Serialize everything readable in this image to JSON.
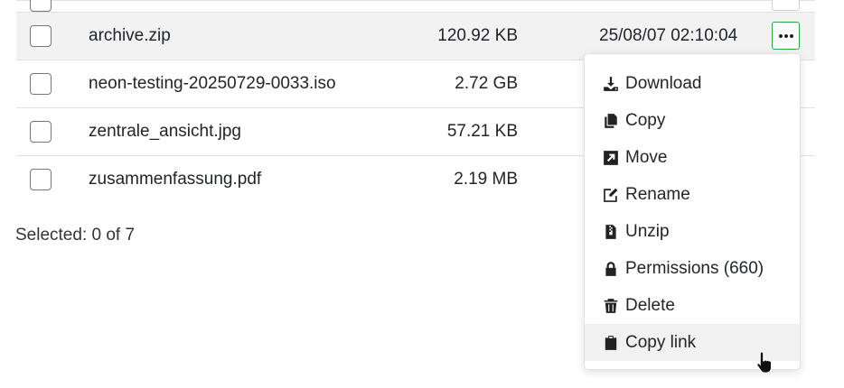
{
  "files": [
    {
      "name": "archive.zip",
      "size": "120.92 KB",
      "date": "25/08/07 02:10:04"
    },
    {
      "name": "neon-testing-20250729-0033.iso",
      "size": "2.72 GB"
    },
    {
      "name": "zentrale_ansicht.jpg",
      "size": "57.21 KB"
    },
    {
      "name": "zusammenfassung.pdf",
      "size": "2.19 MB"
    }
  ],
  "selected_info": "Selected: 0 of 7",
  "menu": {
    "items": [
      {
        "label": "Download",
        "icon": "download-icon"
      },
      {
        "label": "Copy",
        "icon": "copy-icon"
      },
      {
        "label": "Move",
        "icon": "move-icon"
      },
      {
        "label": "Rename",
        "icon": "rename-icon"
      },
      {
        "label": "Unzip",
        "icon": "zip-file-icon"
      },
      {
        "label": "Permissions (660)",
        "icon": "lock-icon"
      },
      {
        "label": "Delete",
        "icon": "trash-icon"
      },
      {
        "label": "Copy link",
        "icon": "clipboard-icon"
      }
    ]
  },
  "colors": {
    "accent": "#28a745",
    "row_highlight": "#f2f2f2",
    "border": "#dee2e6"
  }
}
